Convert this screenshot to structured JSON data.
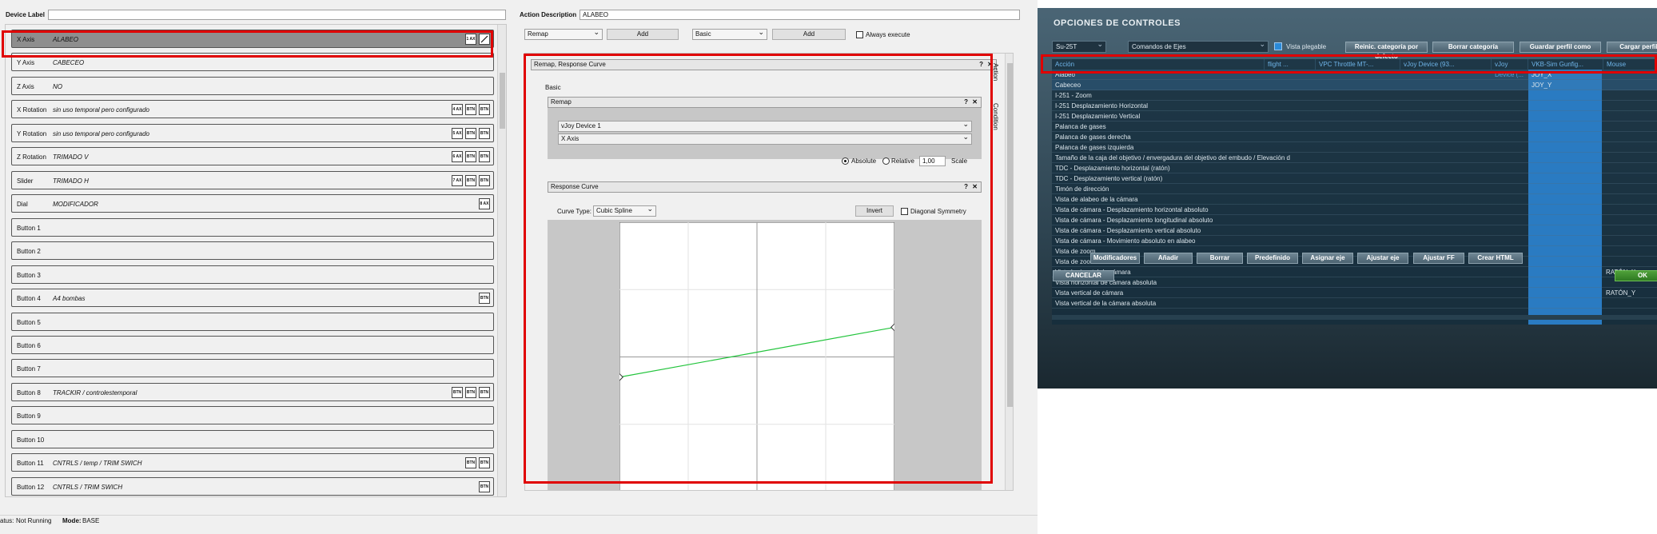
{
  "gremlin": {
    "device_label_caption": "Device Label",
    "device_label_value": "",
    "action_desc_caption": "Action Description",
    "action_desc_value": "ALABEO",
    "rows": [
      {
        "name": "X Axis",
        "desc": "ALABEO",
        "icons": [
          "1 AX",
          "curve"
        ],
        "selected": true
      },
      {
        "name": "Y Axis",
        "desc": "CABECEO",
        "icons": []
      },
      {
        "name": "Z Axis",
        "desc": "NO",
        "icons": []
      },
      {
        "name": "X Rotation",
        "desc": "sin uso temporal pero configurado",
        "icons": [
          "4 AX",
          "BTN",
          "BTN"
        ]
      },
      {
        "name": "Y Rotation",
        "desc": "sin uso temporal pero configurado",
        "icons": [
          "5 AX",
          "BTN",
          "BTN"
        ]
      },
      {
        "name": "Z Rotation",
        "desc": "TRIMADO V",
        "icons": [
          "6 AX",
          "BTN",
          "BTN"
        ]
      },
      {
        "name": "Slider",
        "desc": "TRIMADO H",
        "icons": [
          "7 AX",
          "BTN",
          "BTN"
        ]
      },
      {
        "name": "Dial",
        "desc": "MODIFICADOR",
        "icons": [
          "8 AX"
        ]
      },
      {
        "name": "Button 1",
        "desc": "",
        "icons": []
      },
      {
        "name": "Button 2",
        "desc": "",
        "icons": []
      },
      {
        "name": "Button 3",
        "desc": "",
        "icons": []
      },
      {
        "name": "Button 4",
        "desc": "A4 bombas",
        "icons": [
          "BTN"
        ]
      },
      {
        "name": "Button 5",
        "desc": "",
        "icons": []
      },
      {
        "name": "Button 6",
        "desc": "",
        "icons": []
      },
      {
        "name": "Button 7",
        "desc": "",
        "icons": []
      },
      {
        "name": "Button 8",
        "desc": "TRACKIR / controlestemporal",
        "icons": [
          "BTN",
          "BTN",
          "BTN"
        ]
      },
      {
        "name": "Button 9",
        "desc": "",
        "icons": []
      },
      {
        "name": "Button 10",
        "desc": "",
        "icons": []
      },
      {
        "name": "Button 11",
        "desc": "CNTRLS / temp / TRIM SWICH",
        "icons": [
          "BTN",
          "BTN"
        ]
      },
      {
        "name": "Button 12",
        "desc": "CNTRLS / TRIM SWICH",
        "icons": [
          "BTN"
        ]
      }
    ],
    "toolbar": {
      "remap_select": "Remap",
      "add1": "Add",
      "basic_select": "Basic",
      "add2": "Add",
      "always_execute": "Always execute"
    },
    "side_tabs": [
      "Action",
      "Condition"
    ],
    "container_title": "Remap, Response Curve",
    "basic_label": "Basic",
    "remap": {
      "title": "Remap",
      "device": "vJoy Device 1",
      "axis": "X Axis",
      "absolute": "Absolute",
      "relative": "Relative",
      "scale_value": "1,00",
      "scale_label": "Scale"
    },
    "curve": {
      "title": "Response Curve",
      "curve_type_label": "Curve Type:",
      "curve_type_value": "Cubic Spline",
      "invert": "Invert",
      "diagonal": "Diagonal Symmetry",
      "points": [
        [
          -1.0,
          -0.15
        ],
        [
          1.0,
          0.22
        ]
      ],
      "line_color": "#22c43c"
    },
    "status": {
      "status_caption": "atus:",
      "status_value": "Not Running",
      "mode_caption": "Mode:",
      "mode_value": "BASE"
    },
    "q_glyph": "?",
    "x_glyph": "✕"
  },
  "dcs": {
    "title": "OPCIONES DE CONTROLES",
    "aircraft": "Su-25T",
    "category": "Comandos de Ejes",
    "foldable_view": "Vista plegable",
    "top_buttons": [
      "Reinic. categoría por defecto",
      "Borrar categoría",
      "Guardar perfil como",
      "Cargar perfil"
    ],
    "headers": [
      "Acción",
      "flight ...",
      "VPC Throttle MT-...",
      "vJoy Device (93...",
      "vJoy Device (...",
      "VKB-Sim Gunfig...",
      "Mouse"
    ],
    "rows": [
      {
        "action": "Alabeo",
        "vkb": "JOY_X",
        "mouse": ""
      },
      {
        "action": "Cabeceo",
        "vkb": "JOY_Y",
        "mouse": ""
      },
      {
        "action": "I-251 - Zoom",
        "vkb": "",
        "mouse": ""
      },
      {
        "action": "I-251 Desplazamiento Horizontal",
        "vkb": "",
        "mouse": ""
      },
      {
        "action": "I-251 Desplazamiento Vertical",
        "vkb": "",
        "mouse": ""
      },
      {
        "action": "Palanca de gases",
        "vkb": "",
        "mouse": ""
      },
      {
        "action": "Palanca de gases derecha",
        "vkb": "",
        "mouse": ""
      },
      {
        "action": "Palanca de gases izquierda",
        "vkb": "",
        "mouse": ""
      },
      {
        "action": "Tamaño de la caja del objetivo / envergadura del objetivo del embudo / Elevación d",
        "vkb": "",
        "mouse": ""
      },
      {
        "action": "TDC - Desplazamiento horizontal (ratón)",
        "vkb": "",
        "mouse": ""
      },
      {
        "action": "TDC - Desplazamiento vertical (ratón)",
        "vkb": "",
        "mouse": ""
      },
      {
        "action": "Timón de dirección",
        "vkb": "",
        "mouse": ""
      },
      {
        "action": "Vista de alabeo de la cámara",
        "vkb": "",
        "mouse": ""
      },
      {
        "action": "Vista de cámara - Desplazamiento horizontal absoluto",
        "vkb": "",
        "mouse": ""
      },
      {
        "action": "Vista de cámara - Desplazamiento longitudinal absoluto",
        "vkb": "",
        "mouse": ""
      },
      {
        "action": "Vista de cámara - Desplazamiento vertical absoluto",
        "vkb": "",
        "mouse": ""
      },
      {
        "action": "Vista de cámara - Movimiento absoluto en alabeo",
        "vkb": "",
        "mouse": ""
      },
      {
        "action": "Vista de zoom",
        "vkb": "",
        "mouse": ""
      },
      {
        "action": "Vista de zoom de la cámara",
        "vkb": "",
        "mouse": ""
      },
      {
        "action": "Vista horizontal de cámara",
        "vkb": "",
        "mouse": "RATÓN_X"
      },
      {
        "action": "Vista horizontal de cámara absoluta",
        "vkb": "",
        "mouse": ""
      },
      {
        "action": "Vista vertical de cámara",
        "vkb": "",
        "mouse": "RATÓN_Y"
      },
      {
        "action": "Vista vertical de la cámara absoluta",
        "vkb": "",
        "mouse": ""
      }
    ],
    "bottom_buttons": [
      "Modificadores",
      "Añadir",
      "Borrar",
      "Predefinido",
      "Asignar eje",
      "Ajustar eje",
      "Ajustar FF",
      "Crear HTML"
    ],
    "cancel": "CANCELAR",
    "ok": "OK"
  }
}
